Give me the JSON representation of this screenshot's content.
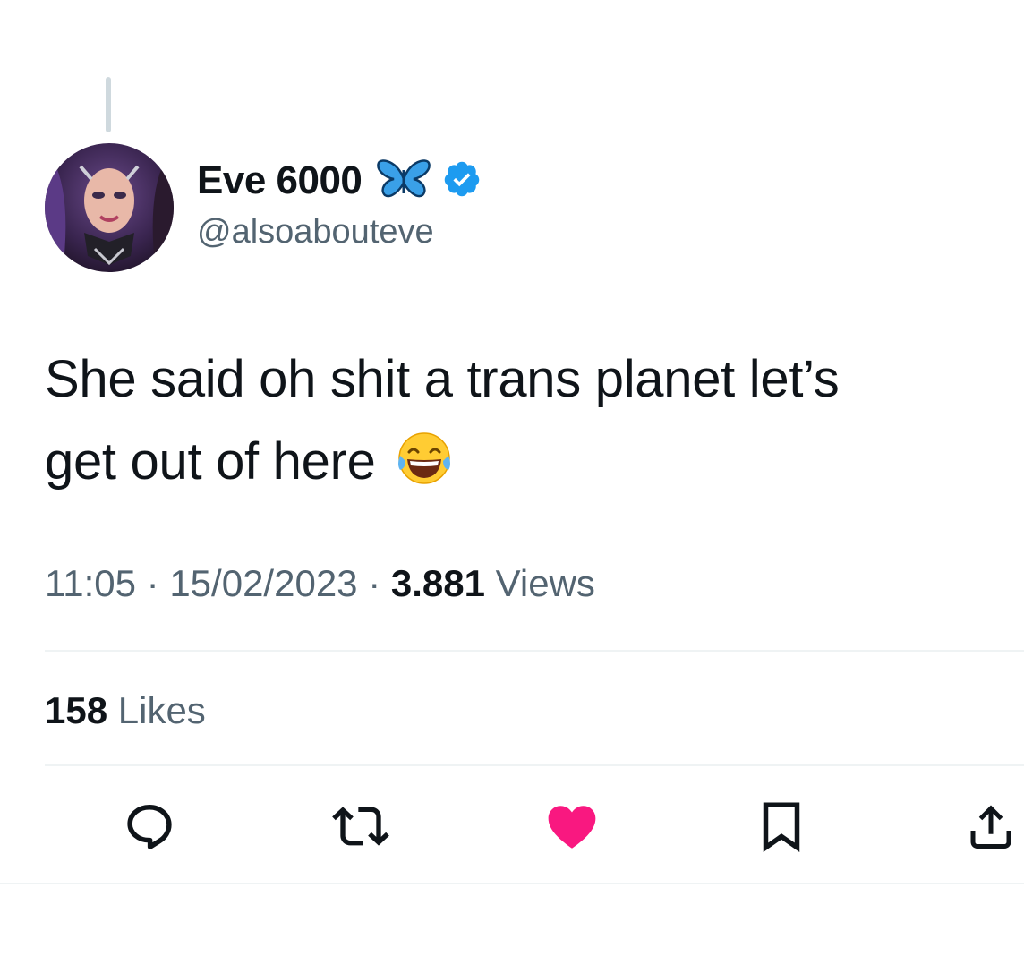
{
  "author": {
    "display_name": "Eve 6000",
    "handle": "@alsoabouteve",
    "verified": true,
    "name_emoji": "butterfly-icon"
  },
  "tweet": {
    "text_line1": "She said oh shit a trans planet let’s",
    "text_line2": "get out of here",
    "emoji": "face-with-tears-of-joy"
  },
  "meta": {
    "time": "11:05",
    "separator": " · ",
    "date": "15/02/2023",
    "views_count": "3.881",
    "views_label": "Views"
  },
  "engagement": {
    "likes_count": "158",
    "likes_label": "Likes"
  },
  "actions": [
    {
      "name": "reply",
      "icon": "reply-icon"
    },
    {
      "name": "retweet",
      "icon": "retweet-icon"
    },
    {
      "name": "like",
      "icon": "heart-icon",
      "active": true
    },
    {
      "name": "bookmark",
      "icon": "bookmark-icon"
    },
    {
      "name": "share",
      "icon": "share-icon"
    }
  ],
  "colors": {
    "primary_text": "#0f1419",
    "secondary_text": "#536471",
    "verified_blue": "#1d9bf0",
    "like_pink": "#f91880",
    "divider": "#eff3f4"
  }
}
